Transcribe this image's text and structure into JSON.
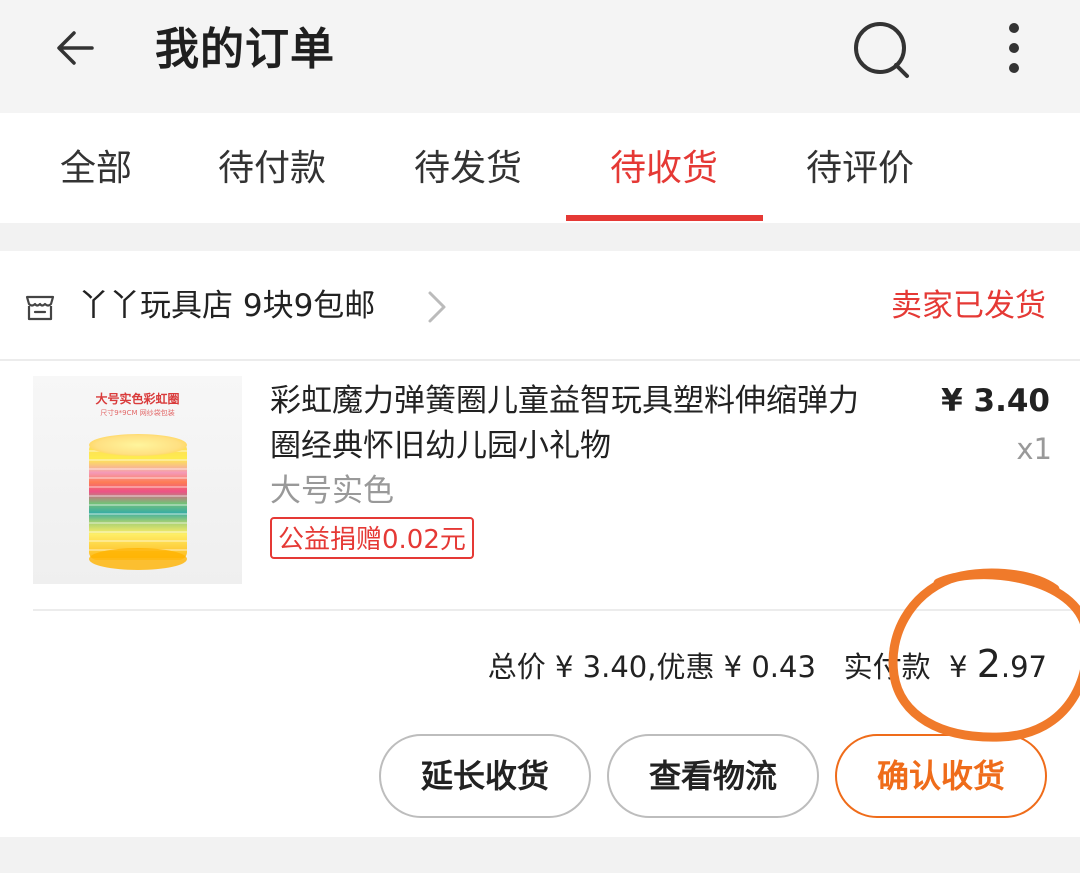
{
  "header": {
    "title": "我的订单",
    "icons": [
      "back-arrow-icon",
      "search-icon",
      "more-vertical-icon"
    ]
  },
  "tabs": [
    {
      "label": "全部",
      "active": false
    },
    {
      "label": "待付款",
      "active": false
    },
    {
      "label": "待发货",
      "active": false
    },
    {
      "label": "待收货",
      "active": true
    },
    {
      "label": "待评价",
      "active": false
    }
  ],
  "order": {
    "store_name": "丫丫玩具店 9块9包邮",
    "status": "卖家已发货",
    "product": {
      "image_caption": "大号实色彩虹圈",
      "image_subcaption": "尺寸9*9CM 网纱袋包装",
      "title": "彩虹魔力弹簧圈儿童益智玩具塑料伸缩弹力圈经典怀旧幼儿园小礼物",
      "variant": "大号实色",
      "charity_badge": "公益捐赠0.02元",
      "price": "¥ 3.40",
      "quantity": "x1"
    },
    "summary": {
      "total_text": "总价 ¥ 3.40,优惠 ¥ 0.43",
      "paid_label": "实付款",
      "currency": "¥",
      "paid_int": "2",
      "paid_dec": ".97"
    },
    "buttons": {
      "extend": "延长收货",
      "logistics": "查看物流",
      "confirm": "确认收货"
    }
  },
  "colors": {
    "accent_red": "#e53935",
    "confirm_orange": "#ef6c1a",
    "annotation_orange": "#f07a2a"
  }
}
